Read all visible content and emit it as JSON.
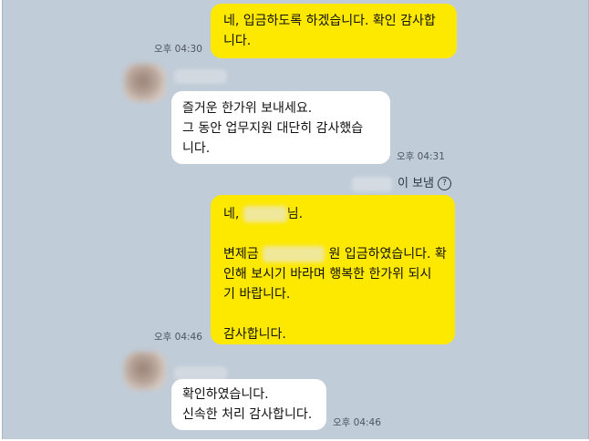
{
  "messages": [
    {
      "sender": "me",
      "lines": [
        "네, 입금하도록 하겠습니다. 확인 감사합",
        "니다."
      ],
      "time": "오후 04:30"
    },
    {
      "sender": "them",
      "lines": [
        "즐거운 한가위 보내세요.",
        "그 동안 업무지원 대단히 감사했습",
        "니다."
      ],
      "time": "오후 04:31"
    },
    {
      "sender": "me",
      "greeting_prefix": "네,",
      "greeting_suffix": "님.",
      "transfer_prefix": "변제금",
      "transfer_suffix": "원 입금하였습니다. 확",
      "lines_after": [
        "인해 보시기 바라며 행복한 한가위 되시",
        "기 바랍니다."
      ],
      "closing": "감사합니다.",
      "time": "오후 04:46"
    },
    {
      "sender": "them",
      "lines": [
        "확인하였습니다.",
        "신속한 처리 감사합니다."
      ],
      "time": "오후 04:46"
    }
  ],
  "read_notice": {
    "label": "이 보냄",
    "icon": "help-circle-icon"
  },
  "colors": {
    "background": "#c0ccd8",
    "my_bubble": "#fde800",
    "their_bubble": "#ffffff"
  }
}
